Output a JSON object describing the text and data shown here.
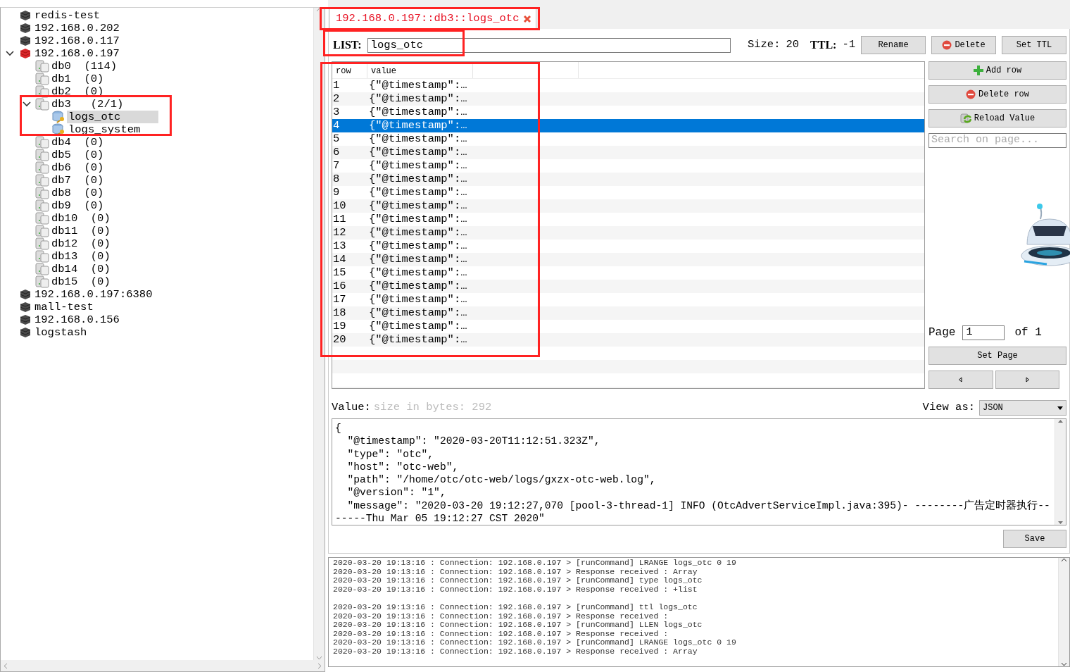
{
  "tree": [
    {
      "label": "redis-test",
      "kind": "server",
      "connected": false
    },
    {
      "label": "192.168.0.202",
      "kind": "server",
      "connected": false
    },
    {
      "label": "192.168.0.117",
      "kind": "server",
      "connected": false
    },
    {
      "label": "192.168.0.197",
      "kind": "server",
      "connected": true,
      "expanded": true,
      "children": [
        {
          "label": "db0  (114)",
          "kind": "db"
        },
        {
          "label": "db1  (0)",
          "kind": "db"
        },
        {
          "label": "db2  (0)",
          "kind": "db"
        },
        {
          "label": "db3   (2/1)",
          "kind": "db",
          "expanded": true,
          "children": [
            {
              "label": "logs_otc",
              "kind": "key",
              "selected": true
            },
            {
              "label": "logs_system",
              "kind": "key",
              "selected": false
            }
          ]
        },
        {
          "label": "db4  (0)",
          "kind": "db"
        },
        {
          "label": "db5  (0)",
          "kind": "db"
        },
        {
          "label": "db6  (0)",
          "kind": "db"
        },
        {
          "label": "db7  (0)",
          "kind": "db"
        },
        {
          "label": "db8  (0)",
          "kind": "db"
        },
        {
          "label": "db9  (0)",
          "kind": "db"
        },
        {
          "label": "db10  (0)",
          "kind": "db"
        },
        {
          "label": "db11  (0)",
          "kind": "db"
        },
        {
          "label": "db12  (0)",
          "kind": "db"
        },
        {
          "label": "db13  (0)",
          "kind": "db"
        },
        {
          "label": "db14  (0)",
          "kind": "db"
        },
        {
          "label": "db15  (0)",
          "kind": "db"
        }
      ]
    },
    {
      "label": "192.168.0.197:6380",
      "kind": "server",
      "connected": false
    },
    {
      "label": "mall-test",
      "kind": "server",
      "connected": false
    },
    {
      "label": "192.168.0.156",
      "kind": "server",
      "connected": false
    },
    {
      "label": "logstash",
      "kind": "server",
      "connected": false
    }
  ],
  "tab": {
    "label": "192.168.0.197::db3::logs_otc"
  },
  "key": {
    "type_label": "LIST:",
    "name": "logs_otc",
    "size_label": "Size:",
    "size": "20",
    "ttl_label": "TTL:",
    "ttl": "-1"
  },
  "key_buttons": [
    {
      "label": "Rename",
      "kind": "plain"
    },
    {
      "label": "Delete",
      "kind": "delete"
    },
    {
      "label": "Set TTL",
      "kind": "plain"
    }
  ],
  "table": {
    "columns": [
      "row",
      "value"
    ],
    "rows": [
      {
        "row": "1",
        "value": "{\"@timestamp\":…",
        "selected": false
      },
      {
        "row": "2",
        "value": "{\"@timestamp\":…",
        "selected": false
      },
      {
        "row": "3",
        "value": "{\"@timestamp\":…",
        "selected": false
      },
      {
        "row": "4",
        "value": "{\"@timestamp\":…",
        "selected": true
      },
      {
        "row": "5",
        "value": "{\"@timestamp\":…",
        "selected": false
      },
      {
        "row": "6",
        "value": "{\"@timestamp\":…",
        "selected": false
      },
      {
        "row": "7",
        "value": "{\"@timestamp\":…",
        "selected": false
      },
      {
        "row": "8",
        "value": "{\"@timestamp\":…",
        "selected": false
      },
      {
        "row": "9",
        "value": "{\"@timestamp\":…",
        "selected": false
      },
      {
        "row": "10",
        "value": "{\"@timestamp\":…",
        "selected": false
      },
      {
        "row": "11",
        "value": "{\"@timestamp\":…",
        "selected": false
      },
      {
        "row": "12",
        "value": "{\"@timestamp\":…",
        "selected": false
      },
      {
        "row": "13",
        "value": "{\"@timestamp\":…",
        "selected": false
      },
      {
        "row": "14",
        "value": "{\"@timestamp\":…",
        "selected": false
      },
      {
        "row": "15",
        "value": "{\"@timestamp\":…",
        "selected": false
      },
      {
        "row": "16",
        "value": "{\"@timestamp\":…",
        "selected": false
      },
      {
        "row": "17",
        "value": "{\"@timestamp\":…",
        "selected": false
      },
      {
        "row": "18",
        "value": "{\"@timestamp\":…",
        "selected": false
      },
      {
        "row": "19",
        "value": "{\"@timestamp\":…",
        "selected": false
      },
      {
        "row": "20",
        "value": "{\"@timestamp\":…",
        "selected": false
      }
    ]
  },
  "side_buttons": [
    {
      "label": "Add row",
      "kind": "add"
    },
    {
      "label": "Delete row",
      "kind": "delete"
    },
    {
      "label": "Reload Value",
      "kind": "reload"
    }
  ],
  "search": {
    "placeholder": "Search on page..."
  },
  "pager": {
    "label": "Page",
    "value": "1",
    "of": "of 1",
    "set_button": "Set Page"
  },
  "value": {
    "label": "Value:",
    "size": "size in bytes: 292",
    "view_label": "View as:",
    "view": "JSON",
    "save_button": "Save",
    "lines": [
      "{",
      "  \"@timestamp\": \"2020-03-20T11:12:51.323Z\",",
      "  \"type\": \"otc\",",
      "  \"host\": \"otc-web\",",
      "  \"path\": \"/home/otc/otc-web/logs/gxzx-otc-web.log\",",
      "  \"@version\": \"1\",",
      "  \"message\": \"2020-03-20 19:12:27,070 [pool-3-thread-1] INFO (OtcAdvertServiceImpl.java:395)- --------广告定时器执行-------Thu Mar 05 19:12:27 CST 2020\""
    ]
  },
  "log": [
    [
      "2020-03-20 19:13:16 : Connection: 192.168.0.197 > [runCommand] LRANGE logs_otc 0 19",
      "2020-03-20 19:13:16 : Connection: 192.168.0.197 > Response received : Array",
      "2020-03-20 19:13:16 : Connection: 192.168.0.197 > [runCommand] type logs_otc",
      "2020-03-20 19:13:16 : Connection: 192.168.0.197 > Response received : +list"
    ],
    [
      "2020-03-20 19:13:16 : Connection: 192.168.0.197 > [runCommand] ttl logs_otc",
      "2020-03-20 19:13:16 : Connection: 192.168.0.197 > Response received :",
      "2020-03-20 19:13:16 : Connection: 192.168.0.197 > [runCommand] LLEN logs_otc",
      "2020-03-20 19:13:16 : Connection: 192.168.0.197 > Response received :",
      "2020-03-20 19:13:16 : Connection: 192.168.0.197 > [runCommand] LRANGE logs_otc 0 19",
      "2020-03-20 19:13:16 : Connection: 192.168.0.197 > Response received : Array"
    ]
  ]
}
